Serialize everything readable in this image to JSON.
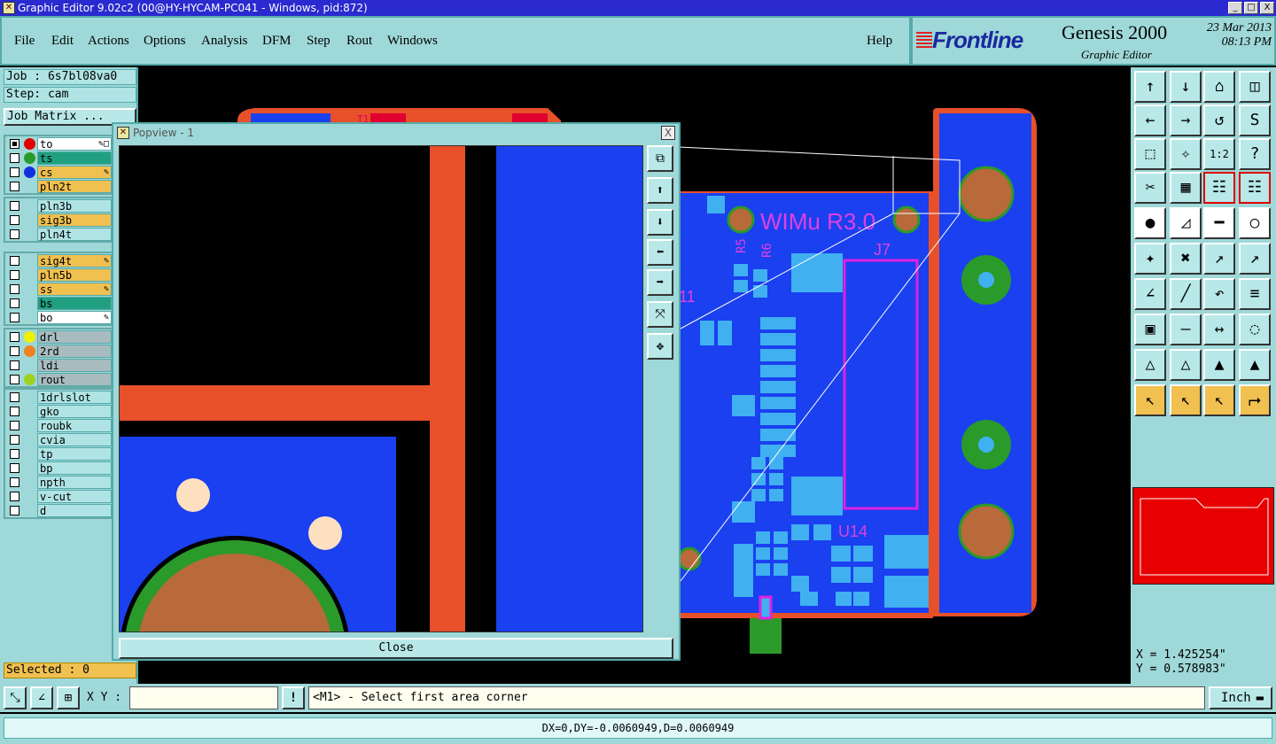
{
  "window": {
    "title": "Graphic Editor 9.02c2 (00@HY-HYCAM-PC041 - Windows, pid:872)",
    "min": "_",
    "max": "□",
    "close": "X"
  },
  "menu": [
    {
      "label": "File"
    },
    {
      "label": "Edit"
    },
    {
      "label": "Actions"
    },
    {
      "label": "Options"
    },
    {
      "label": "Analysis"
    },
    {
      "label": "DFM"
    },
    {
      "label": "Step"
    },
    {
      "label": "Rout"
    },
    {
      "label": "Windows"
    }
  ],
  "help": "Help",
  "branding": {
    "company": "Frontline",
    "product": "Genesis 2000",
    "subtitle": "Graphic Editor",
    "date": "23 Mar 2013",
    "time": "08:13 PM"
  },
  "job": {
    "job_label": "Job : 6s7bl08va0",
    "step_label": "Step: cam",
    "matrix_label": "Job Matrix ..."
  },
  "layers": {
    "group1": [
      {
        "name": "to",
        "color": "#ffffff",
        "dot": "#e00000",
        "mark": "✎□"
      },
      {
        "name": "ts",
        "color": "#20a080",
        "dot": "#2a9a2a",
        "mark": ""
      },
      {
        "name": "cs",
        "color": "#f0c050",
        "dot": "#1030e0",
        "mark": "✎"
      },
      {
        "name": "pln2t",
        "color": "#f0c050",
        "dot": "",
        "mark": ""
      }
    ],
    "group2": [
      {
        "name": "pln3b",
        "color": "#b0e4e4",
        "dot": "",
        "mark": ""
      },
      {
        "name": "sig3b",
        "color": "#f0c050",
        "dot": "",
        "mark": ""
      },
      {
        "name": "pln4t",
        "color": "#b0e4e4",
        "dot": "",
        "mark": ""
      }
    ],
    "group3": [
      {
        "name": "sig4t",
        "color": "#f0c050",
        "dot": "",
        "mark": "✎"
      },
      {
        "name": "pln5b",
        "color": "#f0c050",
        "dot": "",
        "mark": ""
      },
      {
        "name": "ss",
        "color": "#f0c050",
        "dot": "",
        "mark": "✎"
      },
      {
        "name": "bs",
        "color": "#20a080",
        "dot": "",
        "mark": ""
      },
      {
        "name": "bo",
        "color": "#ffffff",
        "dot": "",
        "mark": "✎"
      }
    ],
    "group4": [
      {
        "name": "drl",
        "color": "#a8bcc0",
        "dot": "#f0f000",
        "mark": ""
      },
      {
        "name": "2rd",
        "color": "#a8bcc0",
        "dot": "#f08020",
        "mark": ""
      },
      {
        "name": "ldi",
        "color": "#a8bcc0",
        "dot": "",
        "mark": ""
      },
      {
        "name": "rout",
        "color": "#a8bcc0",
        "dot": "#a0d020",
        "mark": ""
      }
    ],
    "group5": [
      {
        "name": "1drlslot",
        "color": "#b0e4e4",
        "dot": "",
        "mark": ""
      },
      {
        "name": "gko",
        "color": "#b0e4e4",
        "dot": "",
        "mark": ""
      },
      {
        "name": "roubk",
        "color": "#b0e4e4",
        "dot": "",
        "mark": ""
      },
      {
        "name": "cvia",
        "color": "#b0e4e4",
        "dot": "",
        "mark": ""
      },
      {
        "name": "tp",
        "color": "#b0e4e4",
        "dot": "",
        "mark": ""
      },
      {
        "name": "bp",
        "color": "#b0e4e4",
        "dot": "",
        "mark": ""
      },
      {
        "name": "npth",
        "color": "#b0e4e4",
        "dot": "",
        "mark": ""
      },
      {
        "name": "v-cut",
        "color": "#b0e4e4",
        "dot": "",
        "mark": ""
      },
      {
        "name": "d",
        "color": "#b0e4e4",
        "dot": "",
        "mark": ""
      }
    ]
  },
  "selected": "Selected : 0",
  "board_text": {
    "title": "WIMu R3.0",
    "j7": "J7",
    "r5": "R5",
    "r6": "R6",
    "u14": "U14",
    "u11": "11",
    "t1": "T1"
  },
  "popview": {
    "title": "Popview - 1",
    "close": "Close",
    "x": "X"
  },
  "coords": {
    "x": "X = 1.425254\"",
    "y": "Y = 0.578983\""
  },
  "bottom": {
    "xy_label": "X Y :",
    "xy_value": "",
    "excl": "!",
    "prompt": "<M1> - Select first area corner",
    "unit": "Inch"
  },
  "status": "DX=0,DY=-0.0060949,D=0.0060949",
  "toolbar_icons": [
    "zoom-home-icon",
    "zoom-in-icon",
    "home-icon",
    "split-view-icon",
    "pan-left-icon",
    "pan-right-icon",
    "rotate-icon",
    "mirror-icon",
    "fit-icon",
    "center-icon",
    "scale-1-2-icon",
    "help-icon",
    "snap-icon",
    "grid-icon",
    "measure-icon",
    "measure-red-icon",
    "pad-icon",
    "line-icon",
    "ruler-icon",
    "surface-icon",
    "connect-icon",
    "delete-icon",
    "move-icon",
    "copy-icon",
    "arc-icon",
    "slash-icon",
    "undo-icon",
    "features-icon",
    "select-icon",
    "minus-icon",
    "resize-icon",
    "shapes-icon",
    "triangle-icon",
    "triangle2-icon",
    "arch-icon",
    "arch2-icon",
    "pointer-icon",
    "pointer-box-icon",
    "pointer-sel-icon",
    "route-icon"
  ],
  "toolbar_glyphs": [
    "↑",
    "↓",
    "⌂",
    "◫",
    "←",
    "→",
    "↺",
    "Ѕ",
    "⬚",
    "✧",
    "1:2",
    "?",
    "✂",
    "▦",
    "☷",
    "☷",
    "●",
    "◿",
    "━",
    "○",
    "✦",
    "✖",
    "↗",
    "↗",
    "∠",
    "╱",
    "↶",
    "≡",
    "▣",
    "—",
    "↔",
    "◌",
    "△",
    "△",
    "▲",
    "▲",
    "↖",
    "↖",
    "↖",
    "⮣"
  ]
}
